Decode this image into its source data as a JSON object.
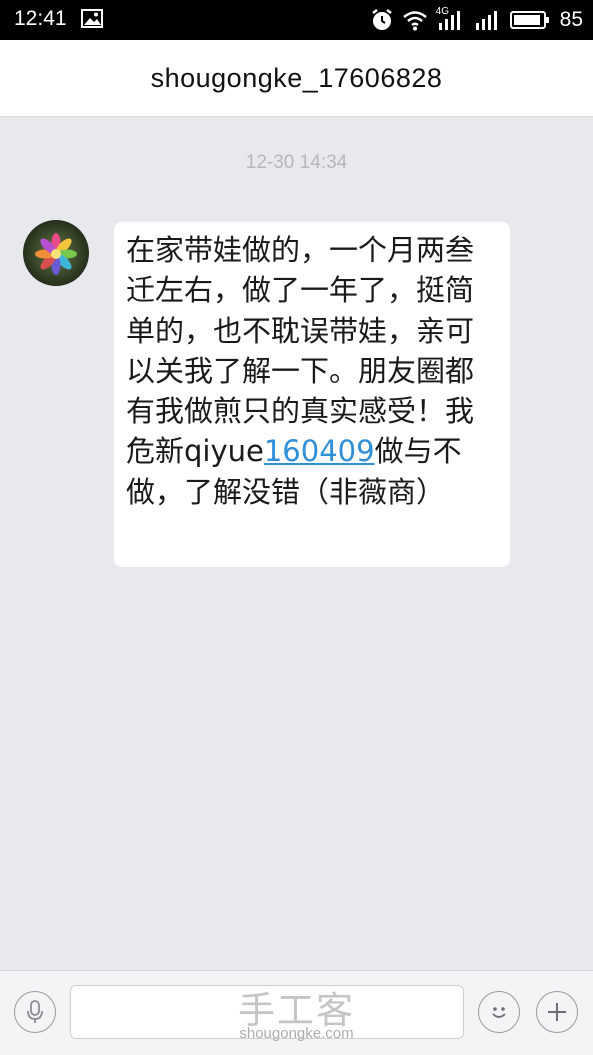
{
  "status_bar": {
    "time": "12:41",
    "network_label": "4G",
    "battery_level": "85"
  },
  "header": {
    "title": "shougongke_17606828"
  },
  "chat": {
    "timestamp": "12-30 14:34",
    "message": {
      "text_before_link": "在家带娃做的，一个月两叁迁左右，做了一年了，挺简单的，也不耽误带娃，亲可以关我了解一下。朋友圈都有我做煎只的真实感受！我危新qiyue",
      "link_text": "160409",
      "text_after_link": "做与不做，了解没错（非薇商）"
    }
  },
  "input_bar": {
    "input_value": ""
  },
  "watermark": {
    "cn": "手工客",
    "en": "shougongke.com"
  },
  "colors": {
    "link": "#2f8fd8",
    "chat_background": "#e8e9ed",
    "bubble": "#ffffff",
    "status_bar": "#000000"
  }
}
